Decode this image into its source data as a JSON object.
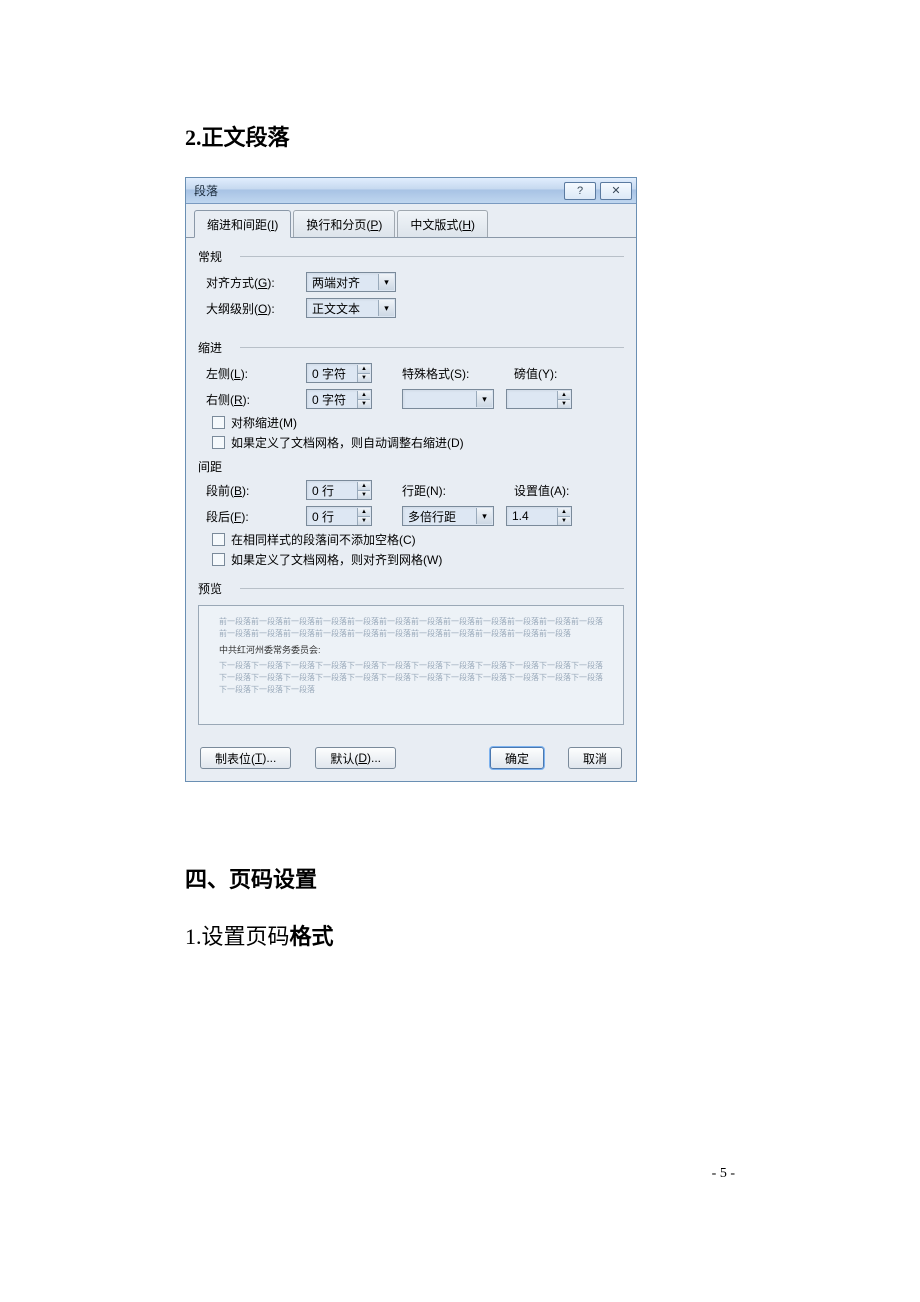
{
  "document": {
    "heading1": "2.正文段落",
    "heading4_prefix": "四、",
    "heading4_text": "页码设置",
    "heading_sub_prefix": "1.",
    "heading_sub_normal": "设置页码",
    "heading_sub_bold": "格式",
    "page_number": "- 5 -"
  },
  "dialog": {
    "title": "段落",
    "help_icon": "?",
    "close_icon": "✕",
    "tabs": {
      "t1_pre": "缩进和间距(",
      "t1_u": "I",
      "t1_post": ")",
      "t2_pre": "换行和分页(",
      "t2_u": "P",
      "t2_post": ")",
      "t3_pre": "中文版式(",
      "t3_u": "H",
      "t3_post": ")"
    },
    "general": {
      "group": "常规",
      "align_label_pre": "对齐方式(",
      "align_u": "G",
      "align_label_post": "):",
      "align_value": "两端对齐",
      "outline_label_pre": "大纲级别(",
      "outline_u": "O",
      "outline_label_post": "):",
      "outline_value": "正文文本"
    },
    "indent": {
      "group": "缩进",
      "left_label_pre": "左侧(",
      "left_u": "L",
      "left_label_post": "):",
      "left_value": "0 字符",
      "right_label_pre": "右侧(",
      "right_u": "R",
      "right_label_post": "):",
      "right_value": "0 字符",
      "special_label_pre": "特殊格式(",
      "special_u": "S",
      "special_label_post": "):",
      "special_value": "",
      "by_label_pre": "磅值(",
      "by_u": "Y",
      "by_label_post": "):",
      "by_value": "",
      "chk1_pre": "对称缩进(",
      "chk1_u": "M",
      "chk1_post": ")",
      "chk2_pre": "如果定义了文档网格，则自动调整右缩进(",
      "chk2_u": "D",
      "chk2_post": ")"
    },
    "spacing": {
      "group": "间距",
      "before_label_pre": "段前(",
      "before_u": "B",
      "before_label_post": "):",
      "before_value": "0 行",
      "after_label_pre": "段后(",
      "after_u": "F",
      "after_label_post": "):",
      "after_value": "0 行",
      "linespace_label_pre": "行距(",
      "linespace_u": "N",
      "linespace_label_post": "):",
      "linespace_value": "多倍行距",
      "at_label_pre": "设置值(",
      "at_u": "A",
      "at_label_post": "):",
      "at_value": "1.4",
      "chk1_pre": "在相同样式的段落间不添加空格(",
      "chk1_u": "C",
      "chk1_post": ")",
      "chk2_pre": "如果定义了文档网格，则对齐到网格(",
      "chk2_u": "W",
      "chk2_post": ")"
    },
    "preview": {
      "label": "预览",
      "filler_top": "前一段落前一段落前一段落前一段落前一段落前一段落前一段落前一段落前一段落前一段落前一段落前一段落前一段落前一段落前一段落前一段落前一段落前一段落前一段落前一段落前一段落前一段落前一段落",
      "sample": "中共红河州委常务委员会:",
      "filler_bottom": "下一段落下一段落下一段落下一段落下一段落下一段落下一段落下一段落下一段落下一段落下一段落下一段落下一段落下一段落下一段落下一段落下一段落下一段落下一段落下一段落下一段落下一段落下一段落下一段落下一段落下一段落下一段落"
    },
    "buttons": {
      "tabs_pre": "制表位(",
      "tabs_u": "T",
      "tabs_post": ")...",
      "default_pre": "默认(",
      "default_u": "D",
      "default_post": ")...",
      "ok": "确定",
      "cancel": "取消"
    }
  }
}
